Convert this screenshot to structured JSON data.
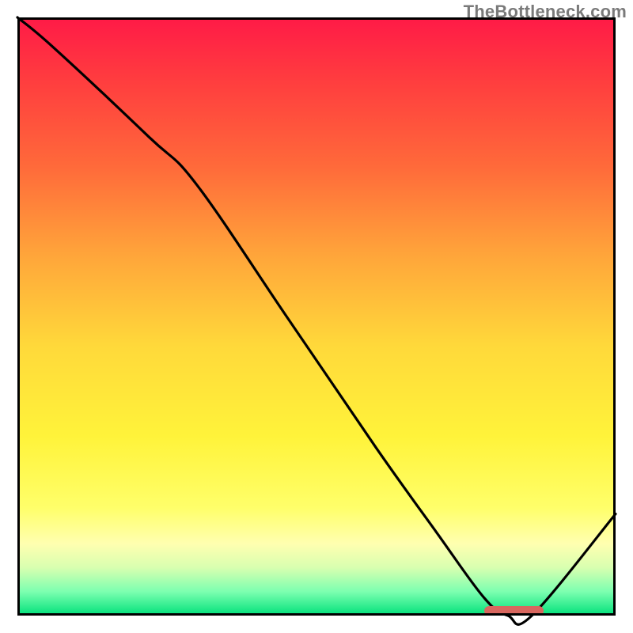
{
  "watermark": "TheBottleneck.com",
  "chart_data": {
    "type": "line",
    "title": "",
    "xlabel": "",
    "ylabel": "",
    "xlim": [
      0,
      100
    ],
    "ylim": [
      0,
      100
    ],
    "series": [
      {
        "name": "bottleneck-curve",
        "x": [
          0,
          6,
          22,
          30,
          45,
          60,
          70,
          78,
          82,
          86,
          100
        ],
        "values": [
          100,
          95,
          80,
          72,
          50,
          28,
          14,
          3,
          0,
          0,
          17
        ]
      }
    ],
    "annotations": [
      {
        "name": "optimal-marker",
        "x_start": 78,
        "x_end": 88,
        "y": 0.8,
        "color": "#d8675f"
      }
    ],
    "gradient_stops": [
      {
        "pct": 0,
        "color": "#ff1a47"
      },
      {
        "pct": 10,
        "color": "#ff3b3f"
      },
      {
        "pct": 25,
        "color": "#ff6a3a"
      },
      {
        "pct": 40,
        "color": "#ffa63a"
      },
      {
        "pct": 55,
        "color": "#ffd93a"
      },
      {
        "pct": 70,
        "color": "#fff33a"
      },
      {
        "pct": 82,
        "color": "#ffff6a"
      },
      {
        "pct": 88,
        "color": "#ffffb0"
      },
      {
        "pct": 92,
        "color": "#d8ffb0"
      },
      {
        "pct": 96,
        "color": "#7cffb0"
      },
      {
        "pct": 100,
        "color": "#00e07a"
      }
    ]
  }
}
